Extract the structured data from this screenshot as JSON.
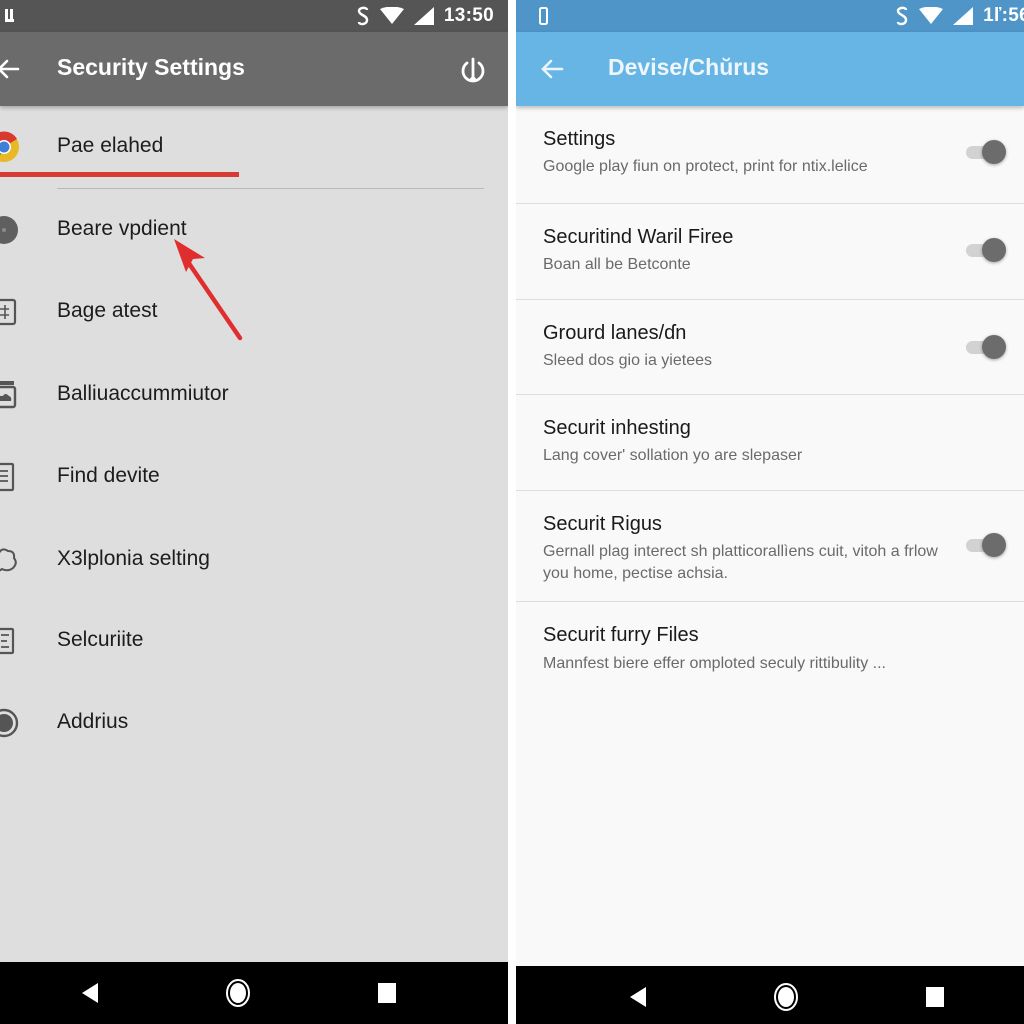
{
  "left_screen": {
    "status_bar": {
      "time": "13:50",
      "icons": [
        "notification-icon",
        "sync-icon",
        "wifi-icon",
        "signal-icon"
      ]
    },
    "app_bar": {
      "title": "Security Settings",
      "back_icon": "arrow-left-icon",
      "action_icon": "power-download-icon"
    },
    "menu_items": [
      {
        "label": "Pae elahed",
        "icon": "chrome-icon",
        "highlighted": true
      },
      {
        "label": "Beare vpdient",
        "icon": "gear-circle-icon"
      },
      {
        "label": "Bage atest",
        "icon": "grid-icon"
      },
      {
        "label": "Balliuaccummiutor",
        "icon": "cloud-box-icon"
      },
      {
        "label": "Find devite",
        "icon": "list-icon"
      },
      {
        "label": "X3lplonia selting",
        "icon": "cloud-icon"
      },
      {
        "label": "Selcuriite",
        "icon": "document-icon"
      },
      {
        "label": "Addrius",
        "icon": "radio-icon"
      }
    ],
    "annotation": {
      "type": "red-arrow",
      "points_to": "Beare vpdient",
      "color": "#e02e2e"
    },
    "nav_bar": [
      "back",
      "home",
      "recents"
    ]
  },
  "right_screen": {
    "status_bar": {
      "time": "1ľ:56",
      "icons": [
        "battery-icon",
        "sync-icon",
        "wifi-icon",
        "signal-icon"
      ]
    },
    "app_bar": {
      "title": "Devise/Chŭrus",
      "back_icon": "arrow-left-icon"
    },
    "settings": [
      {
        "title": "Settings",
        "subtitle": "Google play fiun on protect, print for ntix.lelice",
        "toggle": true,
        "on": true
      },
      {
        "title": "Securitind Waril Firee",
        "subtitle": "Boan all be Betconte",
        "toggle": true,
        "on": true
      },
      {
        "title": "Grourd lanes/ɗn",
        "subtitle": "Sleed dos gio ia yietees",
        "toggle": true,
        "on": true
      },
      {
        "title": "Securit inhesting",
        "subtitle": "Lang cover' sollation yo are slepaser",
        "toggle": false
      },
      {
        "title": "Securit Rigus",
        "subtitle": "Gernall plag interect sh platticorallìens cuit, vitoh a frlow you home, pectise achsia.",
        "toggle": true,
        "on": true
      },
      {
        "title": "Securit furry Files",
        "subtitle": "Mannfest biere effer omploted seculy rittibulity ...",
        "toggle": false
      }
    ],
    "nav_bar": [
      "back",
      "home",
      "recents"
    ]
  },
  "colors": {
    "left_status_bar": "#555555",
    "left_app_bar": "#6b6b6b",
    "left_background": "#dedede",
    "right_status_bar": "#4f95c8",
    "right_app_bar": "#67b5e4",
    "right_background": "#f9f9f9",
    "highlight_red": "#d83a34",
    "toggle_thumb": "#6c6c6c"
  }
}
